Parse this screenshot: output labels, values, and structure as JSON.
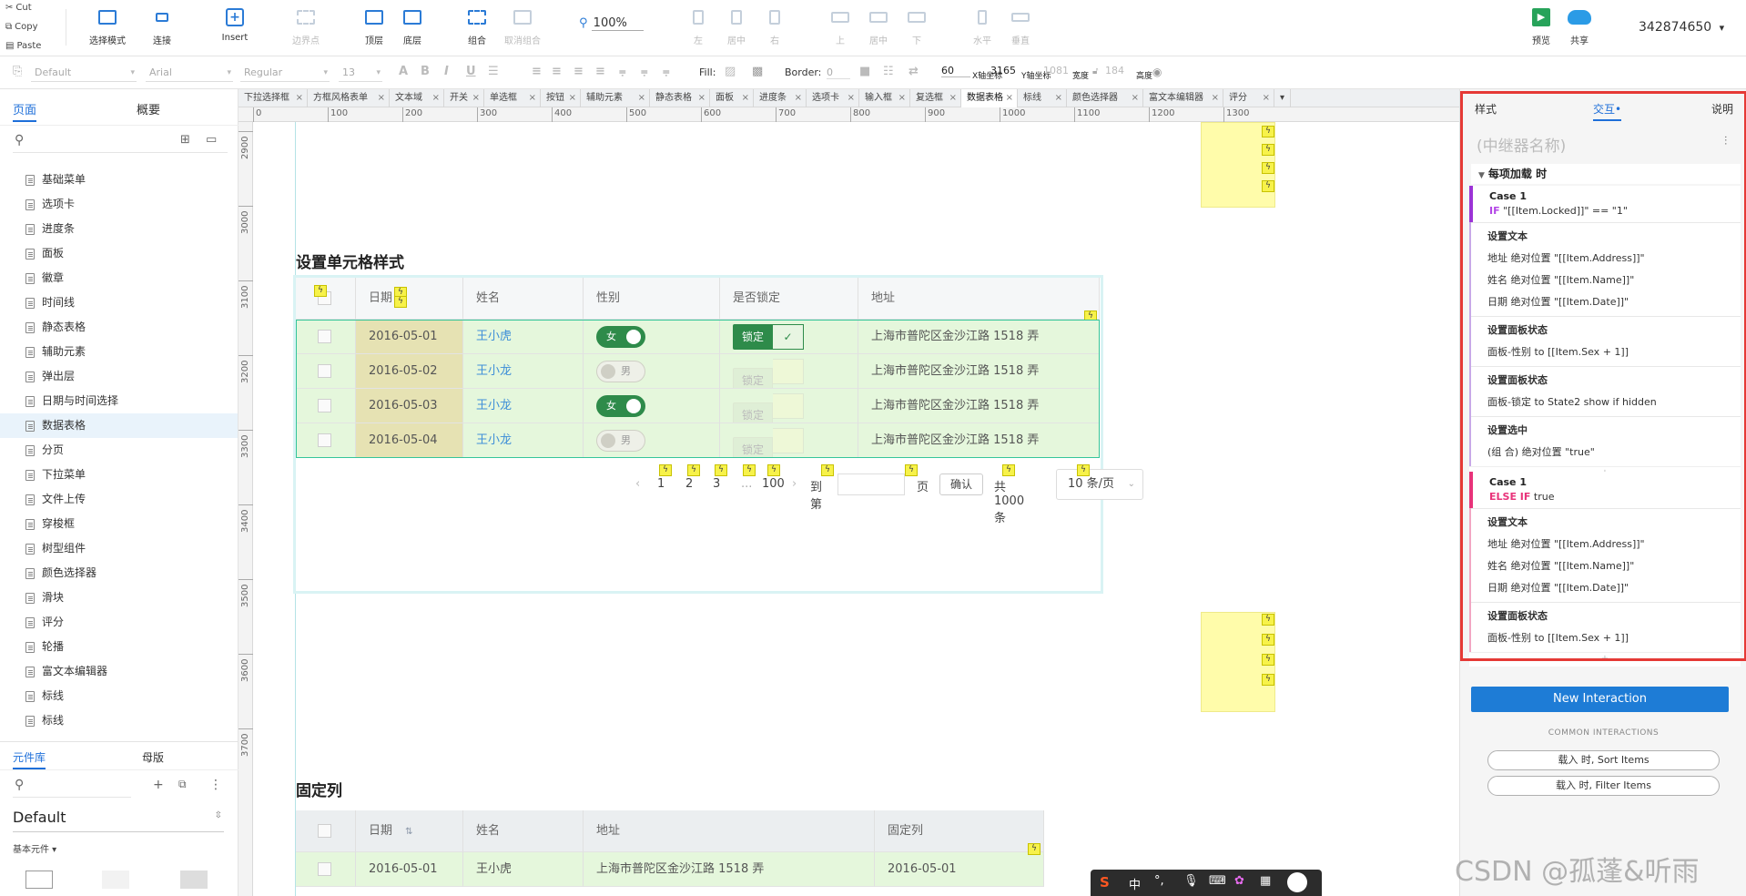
{
  "clipboard": {
    "cut": "Cut",
    "copy": "Copy",
    "paste": "Paste"
  },
  "toolbar": {
    "select_mode": "选择模式",
    "connect": "连接",
    "insert": "Insert",
    "boundary": "边界点",
    "top": "顶层",
    "bottom": "底层",
    "group": "组合",
    "ungroup": "取消组合",
    "zoom": "100%",
    "align_left": "左",
    "align_center": "居中",
    "align_right": "右",
    "align_top": "上",
    "align_middle": "居中",
    "align_bottom": "下",
    "dist_h": "水平",
    "dist_v": "垂直",
    "preview": "预览",
    "share": "共享",
    "user": "342874650"
  },
  "format": {
    "style": "Default",
    "font": "Arial",
    "weight": "Regular",
    "size": "13",
    "fill_label": "Fill:",
    "border_label": "Border:",
    "border_value": "0",
    "x_value": "60",
    "x_label": "X轴坐标",
    "y_value": "3165",
    "y_label": "Y轴坐标",
    "w_value": "1081",
    "w_label": "宽度",
    "h_value": "184",
    "h_label": "高度"
  },
  "left_panel": {
    "tab_pages": "页面",
    "tab_outline": "概要",
    "pages": [
      "基础菜单",
      "选项卡",
      "进度条",
      "面板",
      "徽章",
      "时间线",
      "静态表格",
      "辅助元素",
      "弹出层",
      "日期与时间选择",
      "数据表格",
      "分页",
      "下拉菜单",
      "文件上传",
      "穿梭框",
      "树型组件",
      "颜色选择器",
      "滑块",
      "评分",
      "轮播",
      "富文本编辑器",
      "标线",
      "标线"
    ],
    "selected_page": "数据表格",
    "tab_library": "元件库",
    "tab_masters": "母版",
    "library_select": "Default",
    "library_group": "基本元件 ▾"
  },
  "canvas": {
    "page_tabs": [
      "下拉选择框",
      "方框风格表单",
      "文本域",
      "开关",
      "单选框",
      "按钮",
      "辅助元素",
      "静态表格",
      "面板",
      "进度条",
      "选项卡",
      "输入框",
      "复选框",
      "数据表格",
      "标线",
      "颜色选择器",
      "富文本编辑器",
      "评分"
    ],
    "active_tab": "数据表格",
    "hruler": [
      "0",
      "100",
      "200",
      "300",
      "400",
      "500",
      "600",
      "700",
      "800",
      "900",
      "1000",
      "1100",
      "1200",
      "1300"
    ],
    "vruler": [
      "2900",
      "3000",
      "3100",
      "3200",
      "3300",
      "3400",
      "3500",
      "3600",
      "3700"
    ]
  },
  "section1": {
    "title": "设置单元格样式",
    "headers": [
      "日期",
      "姓名",
      "性别",
      "是否锁定",
      "地址"
    ],
    "rows": [
      {
        "date": "2016-05-01",
        "name": "王小虎",
        "sex": "女",
        "sex_on": true,
        "lock": "锁定",
        "lock_on": true,
        "address": "上海市普陀区金沙江路 1518 弄"
      },
      {
        "date": "2016-05-02",
        "name": "王小龙",
        "sex": "男",
        "sex_on": false,
        "lock": "锁定",
        "lock_on": false,
        "address": "上海市普陀区金沙江路 1518 弄"
      },
      {
        "date": "2016-05-03",
        "name": "王小龙",
        "sex": "女",
        "sex_on": true,
        "lock": "锁定",
        "lock_on": false,
        "address": "上海市普陀区金沙江路 1518 弄"
      },
      {
        "date": "2016-05-04",
        "name": "王小龙",
        "sex": "男",
        "sex_on": false,
        "lock": "锁定",
        "lock_on": false,
        "address": "上海市普陀区金沙江路 1518 弄"
      }
    ],
    "pager": {
      "p1": "1",
      "p2": "2",
      "p3": "3",
      "ellipsis": "...",
      "p100": "100",
      "goto": "到第",
      "page": "页",
      "confirm": "确认",
      "total": "共 1000条",
      "size": "10 条/页"
    }
  },
  "section2": {
    "title": "固定列",
    "headers": [
      "日期",
      "姓名",
      "地址",
      "固定列"
    ],
    "row": {
      "date": "2016-05-01",
      "name": "王小虎",
      "address": "上海市普陀区金沙江路 1518 弄",
      "fixed": "2016-05-01"
    }
  },
  "right_panel": {
    "tab_style": "样式",
    "tab_interact": "交互",
    "tab_notes": "说明",
    "name_placeholder": "(中继器名称)",
    "event": "每项加载 时",
    "case1": {
      "title": "Case 1",
      "cond_kw": "IF",
      "cond": "\"[[Item.Locked]]\" == \"1\"",
      "act1": "设置文本",
      "a1l1": "地址 绝对位置 \"[[Item.Address]]\"",
      "a1l2": "姓名 绝对位置 \"[[Item.Name]]\"",
      "a1l3": "日期 绝对位置 \"[[Item.Date]]\"",
      "act2": "设置面板状态",
      "a2l1": "面板-性别 to [[Item.Sex + 1]]",
      "act3": "设置面板状态",
      "a3l1": "面板-锁定 to State2 show if hidden",
      "act4": "设置选中",
      "a4l1": "(组 合) 绝对位置 \"true\""
    },
    "case2": {
      "title": "Case 1",
      "cond_kw": "ELSE IF",
      "cond": "true",
      "act1": "设置文本",
      "a1l1": "地址 绝对位置 \"[[Item.Address]]\"",
      "a1l2": "姓名 绝对位置 \"[[Item.Name]]\"",
      "a1l3": "日期 绝对位置 \"[[Item.Date]]\"",
      "act2": "设置面板状态",
      "a2l1": "面板-性别 to [[Item.Sex + 1]]"
    },
    "new_interaction": "New Interaction",
    "common_title": "COMMON INTERACTIONS",
    "common1": "载入 时, Sort Items",
    "common2": "载入 时, Filter Items"
  },
  "taskbar": {
    "ime": "中",
    "punct": "°,"
  },
  "watermark": "CSDN @孤蓬&听雨",
  "colors": {
    "accent": "#1e6fd9",
    "highlight_frame": "#e53935",
    "row_green": "#e5f7dc",
    "toggle_green": "#2e8b4a"
  }
}
